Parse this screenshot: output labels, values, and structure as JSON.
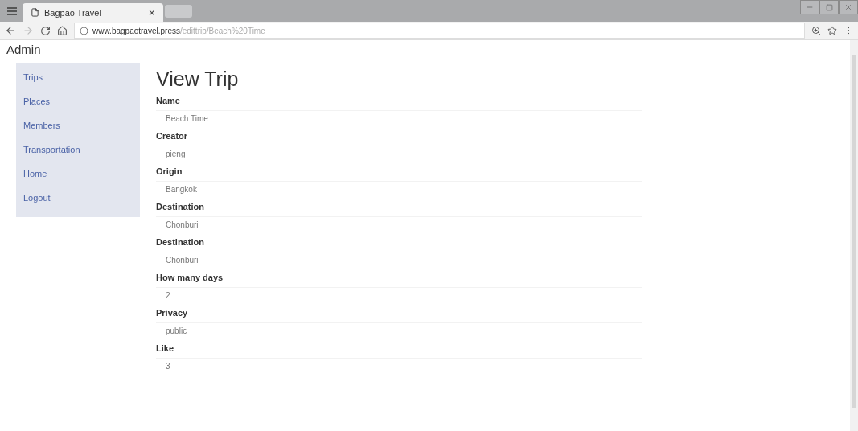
{
  "browser": {
    "tab_title": "Bagpao Travel",
    "tab_close": "×",
    "url_host": "www.bagpaotravel.press",
    "url_path": "/edittrip/Beach%20Time"
  },
  "site_title": "Admin",
  "sidebar": {
    "items": [
      {
        "label": "Trips"
      },
      {
        "label": "Places"
      },
      {
        "label": "Members"
      },
      {
        "label": "Transportation"
      },
      {
        "label": "Home"
      },
      {
        "label": "Logout"
      }
    ]
  },
  "heading": "View Trip",
  "fields": [
    {
      "label": "Name",
      "value": "Beach Time"
    },
    {
      "label": "Creator",
      "value": "pieng"
    },
    {
      "label": "Origin",
      "value": "Bangkok"
    },
    {
      "label": "Destination",
      "value": "Chonburi"
    },
    {
      "label": "Destination",
      "value": "Chonburi"
    },
    {
      "label": "How many days",
      "value": "2"
    },
    {
      "label": "Privacy",
      "value": "public"
    },
    {
      "label": "Like",
      "value": "3"
    }
  ]
}
